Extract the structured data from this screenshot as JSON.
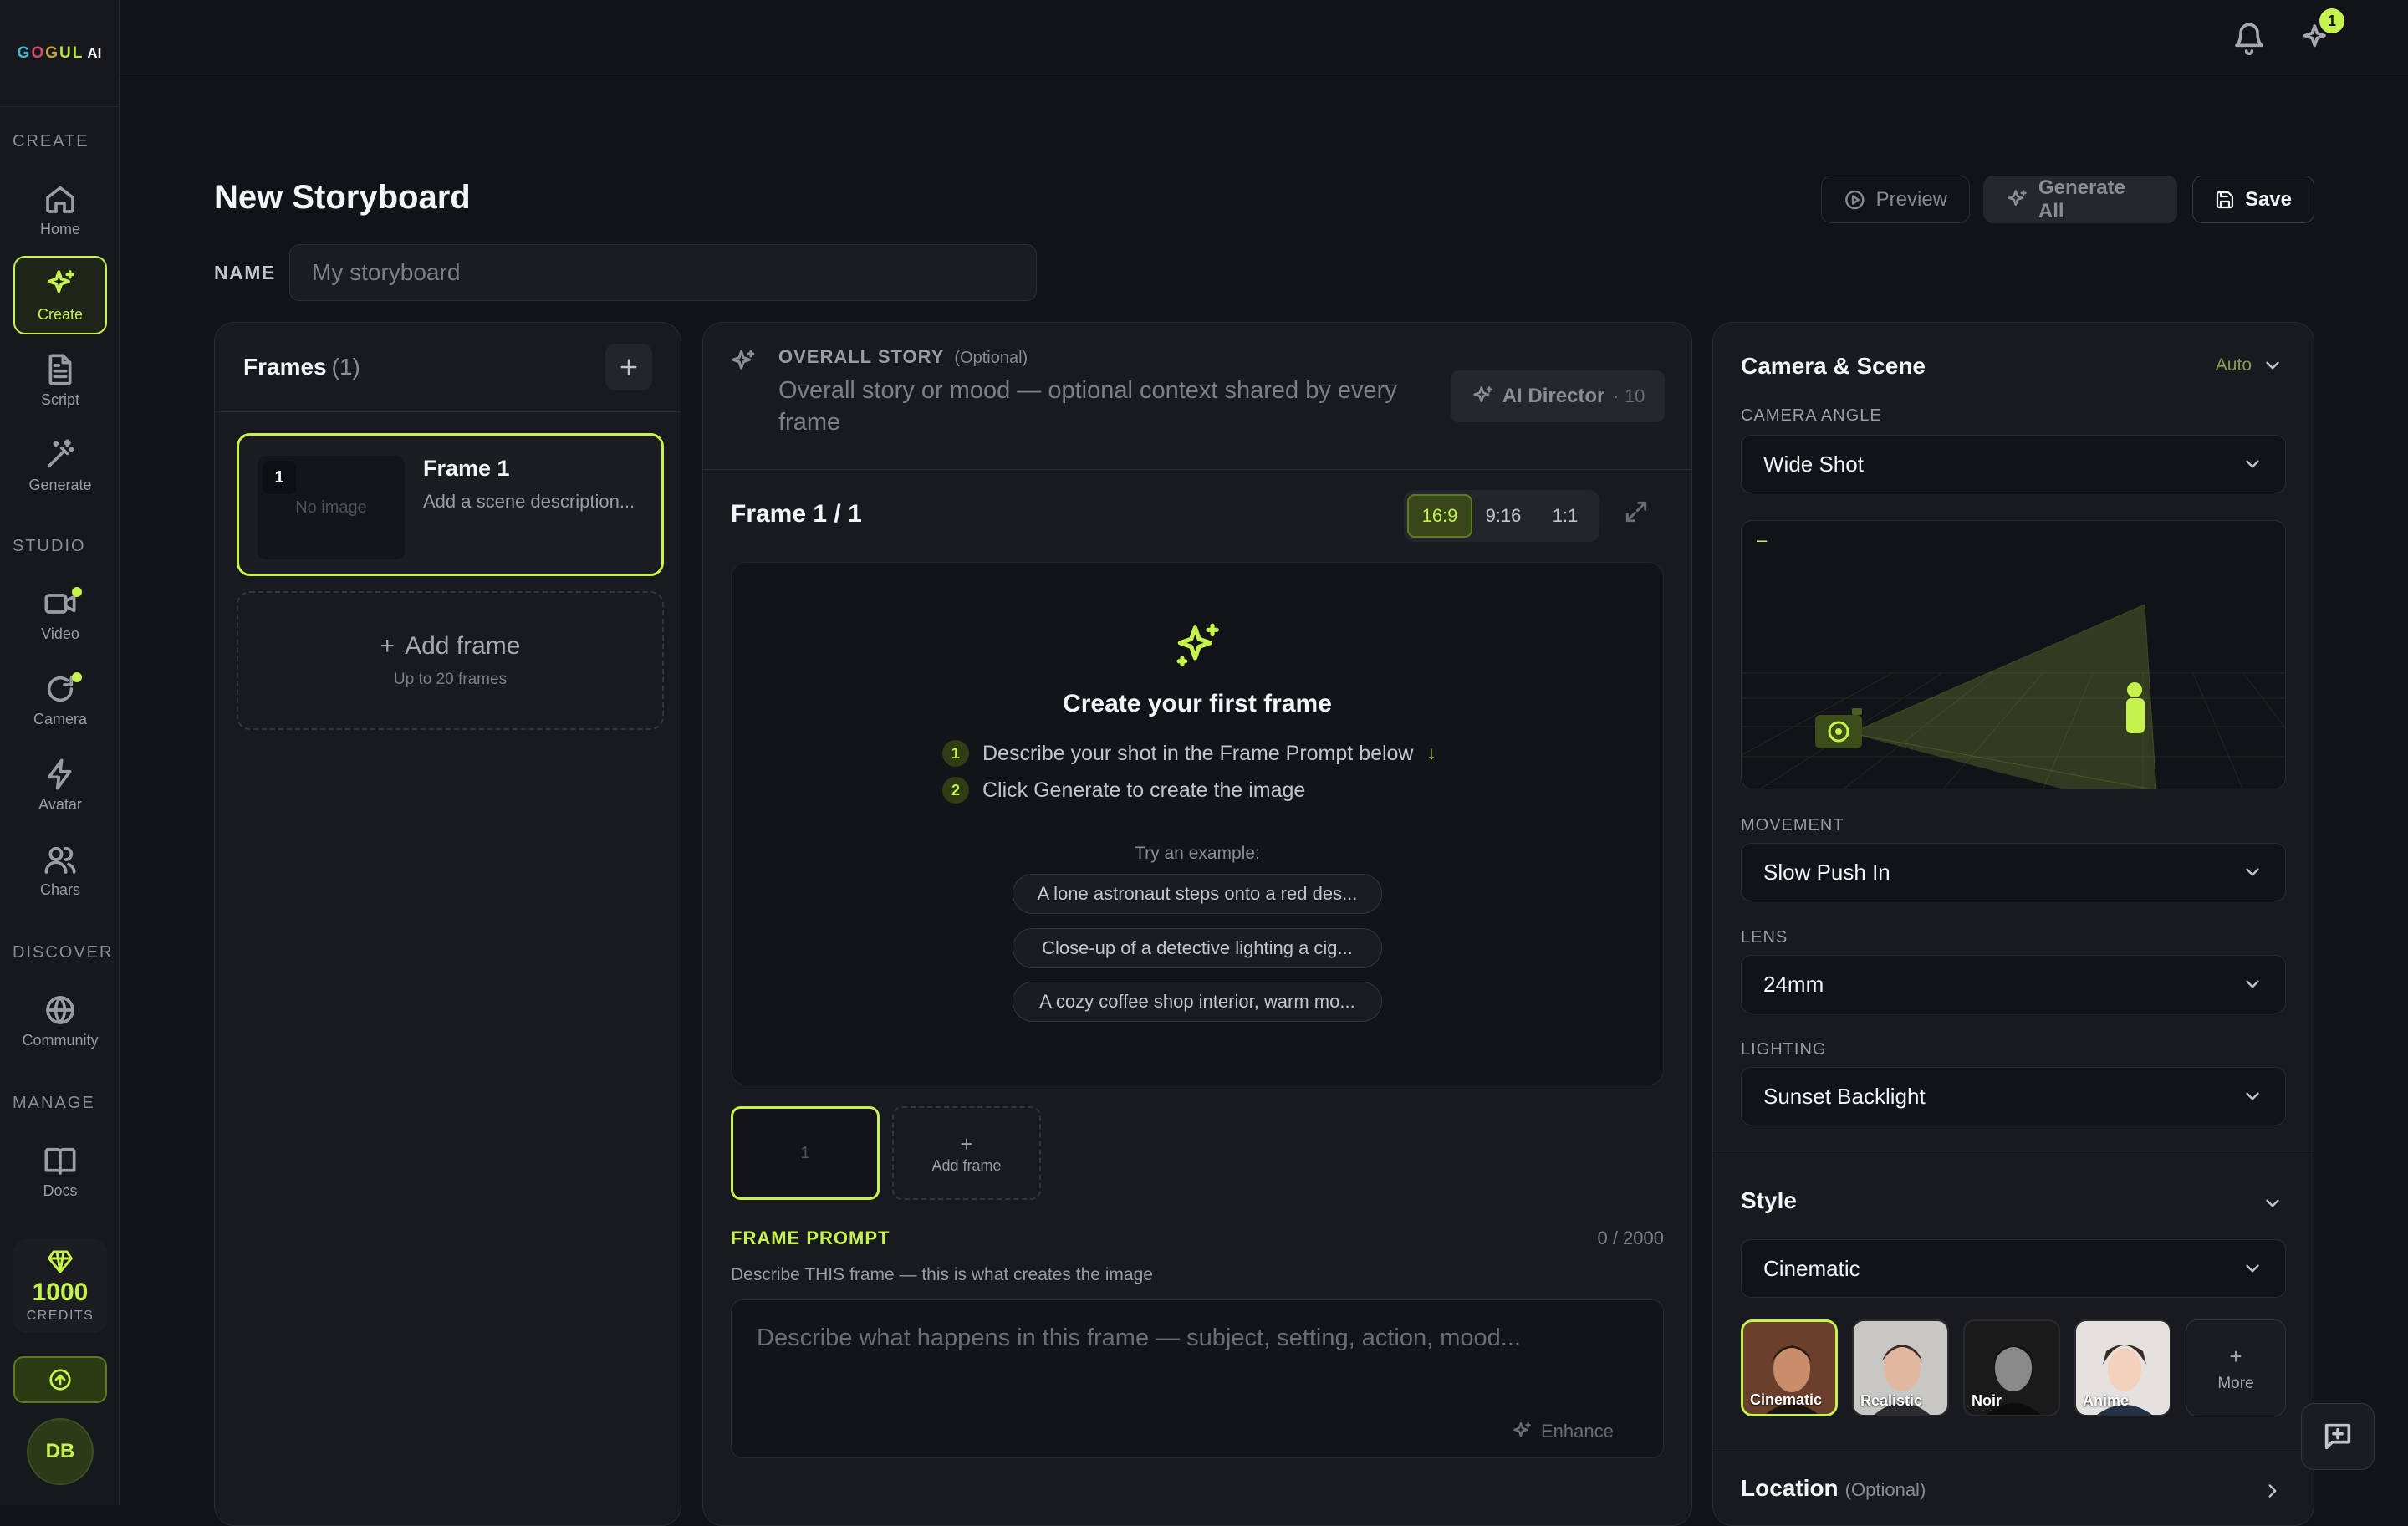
{
  "app": {
    "logo_letters": [
      "G",
      "O",
      "G",
      "U",
      "L"
    ],
    "logo_suffix": "AI"
  },
  "sidebar": {
    "sections": {
      "create": "CREATE",
      "studio": "STUDIO",
      "discover": "DISCOVER",
      "manage": "MANAGE"
    },
    "items": [
      {
        "label": "Home",
        "icon": "home-icon"
      },
      {
        "label": "Create",
        "icon": "sparkle-icon",
        "active": true
      },
      {
        "label": "Script",
        "icon": "document-icon"
      },
      {
        "label": "Generate",
        "icon": "magic-wand-icon"
      },
      {
        "label": "Video",
        "icon": "video-icon",
        "dot": true
      },
      {
        "label": "Camera",
        "icon": "refresh-icon",
        "dot": true
      },
      {
        "label": "Avatar",
        "icon": "bolt-icon"
      },
      {
        "label": "Chars",
        "icon": "users-icon"
      },
      {
        "label": "Community",
        "icon": "globe-icon"
      },
      {
        "label": "Docs",
        "icon": "book-icon"
      }
    ],
    "credits": {
      "value": "1000",
      "label": "CREDITS"
    },
    "user_initials": "DB"
  },
  "topbar": {
    "notification_badge": "1"
  },
  "header": {
    "title": "New Storyboard",
    "preview_label": "Preview",
    "generate_all_label": "Generate All",
    "save_label": "Save",
    "name_label": "NAME",
    "name_placeholder": "My storyboard",
    "name_value": ""
  },
  "frames_panel": {
    "title": "Frames",
    "count": "(1)",
    "frame": {
      "number": "1",
      "thumb_text": "No image",
      "name": "Frame 1",
      "description": "Add a scene description..."
    },
    "add_frame": {
      "label": "Add frame",
      "hint": "Up to 20 frames"
    }
  },
  "story": {
    "label": "OVERALL STORY",
    "optional": "(Optional)",
    "placeholder": "Overall story or mood — optional context shared by every frame",
    "ai_director_label": "AI Director",
    "ai_director_cost": "· 10"
  },
  "frame_editor": {
    "counter": "Frame 1 / 1",
    "ratios": [
      {
        "label": "16:9",
        "active": true
      },
      {
        "label": "9:16"
      },
      {
        "label": "1:1"
      }
    ],
    "empty_title": "Create your first frame",
    "steps": [
      {
        "n": "1",
        "text": "Describe your shot in the Frame Prompt below",
        "arrow": "↓"
      },
      {
        "n": "2",
        "text": "Click Generate to create the image"
      }
    ],
    "try_label": "Try an example:",
    "examples": [
      "A lone astronaut steps onto a red des...",
      "Close-up of a detective lighting a cig...",
      "A cozy coffee shop interior, warm mo..."
    ],
    "strip_thumb": "1",
    "strip_add": "Add frame",
    "prompt_label": "FRAME PROMPT",
    "prompt_count": "0 / 2000",
    "prompt_hint": "Describe THIS frame — this is what creates the image",
    "prompt_placeholder": "Describe what happens in this frame — subject, setting, action, mood...",
    "enhance_label": "Enhance"
  },
  "camera": {
    "title": "Camera & Scene",
    "auto_label": "Auto",
    "angle_label": "CAMERA ANGLE",
    "angle_value": "Wide Shot",
    "viz_marker": "–",
    "movement_label": "MOVEMENT",
    "movement_value": "Slow Push In",
    "lens_label": "LENS",
    "lens_value": "24mm",
    "lighting_label": "LIGHTING",
    "lighting_value": "Sunset Backlight"
  },
  "style": {
    "title": "Style",
    "value": "Cinematic",
    "presets": [
      {
        "label": "Cinematic",
        "active": true,
        "bg": "#6a3f2c",
        "face": "#c98d6a",
        "hair": "#2a1a14"
      },
      {
        "label": "Realistic",
        "bg": "#c9c7c4",
        "face": "#e0b8a0",
        "hair": "#3a2a24"
      },
      {
        "label": "Noir",
        "bg": "#1a1a1a",
        "face": "#8a8a8a",
        "hair": "#111111"
      },
      {
        "label": "Anime",
        "bg": "#e4e1df",
        "face": "#f2d2bc",
        "hair": "#3a2a22"
      }
    ],
    "more_label": "More"
  },
  "location": {
    "title": "Location",
    "optional": "(Optional)"
  },
  "colors": {
    "accent": "#c6f24e",
    "background": "#121318",
    "panel": "#191a1f"
  }
}
